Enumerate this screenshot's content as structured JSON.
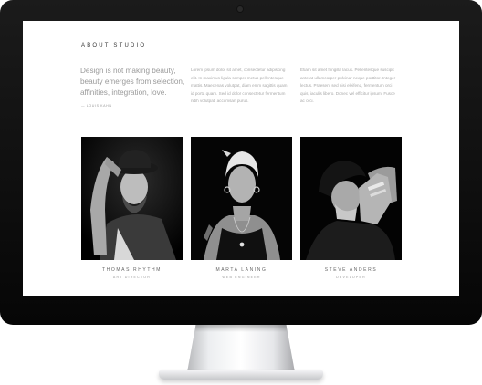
{
  "page": {
    "heading": "ABOUT STUDIO",
    "quote": "Design is not making beauty, beauty emerges from selection, affinities, integration, love.",
    "quote_author": "— LOUIS KAHN",
    "column_1": "Lorem ipsum dolor sit amet, consectetur adipiscing elit. In maximus ligula semper metus pellentesque mattis. Maecenas volutpat, diam enim sagittis quam, id porta quam. Sed id dolor consectetur fermentum nibh volutpat, accumsan purus.",
    "column_2": "Etiam sit amet fringilla lacus. Pellentesque suscipit ante at ullamcorper pulvinar neque porttitor. Integer lectus. Praesent sed nisi eleifend, fermentum orci quis, iaculis libero. Donec vel efficitur ipsum. Fusce ac orci."
  },
  "team": [
    {
      "name": "THOMAS RHYTHM",
      "role": "ART DIRECTOR"
    },
    {
      "name": "MARTA LANING",
      "role": "WEB ENGINEER"
    },
    {
      "name": "STEVE ANDERS",
      "role": "DEVELOPER"
    }
  ]
}
